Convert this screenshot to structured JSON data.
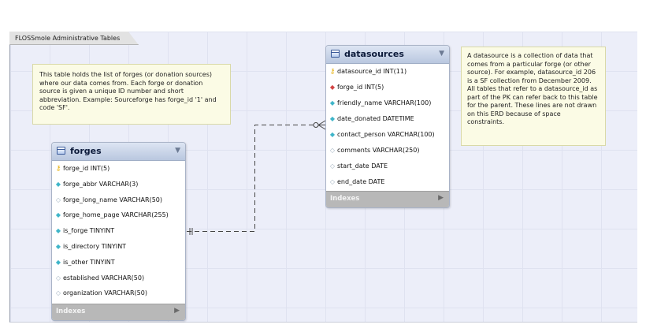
{
  "layer": {
    "title": "FLOSSmole Administrative Tables"
  },
  "notes": {
    "forges": "This table holds the list of forges (or donation sources) where our data comes from. Each forge or donation source is given a unique ID number and short abbreviation. Example: Sourceforge has forge_id '1' and code 'SF'.",
    "datasources": "A datasource is a collection of data that comes from a particular forge (or other source). For example, datasource_id 206 is a SF collection from December 2009. All tables that refer to a datasource_id as part of the PK can refer back to this table for the parent. These lines are not drawn on this ERD because of space constraints."
  },
  "tables": {
    "forges": {
      "name": "forges",
      "columns": [
        {
          "label": "forge_id INT(5)",
          "icon": "primary-key-icon"
        },
        {
          "label": "forge_abbr VARCHAR(3)",
          "icon": "not-null-column-icon"
        },
        {
          "label": "forge_long_name VARCHAR(50)",
          "icon": "nullable-column-icon"
        },
        {
          "label": "forge_home_page VARCHAR(255)",
          "icon": "not-null-column-icon"
        },
        {
          "label": "is_forge TINYINT",
          "icon": "not-null-column-icon"
        },
        {
          "label": "is_directory TINYINT",
          "icon": "not-null-column-icon"
        },
        {
          "label": "is_other TINYINT",
          "icon": "not-null-column-icon"
        },
        {
          "label": "established VARCHAR(50)",
          "icon": "nullable-column-icon"
        },
        {
          "label": "organization VARCHAR(50)",
          "icon": "nullable-column-icon"
        }
      ],
      "footer": "Indexes"
    },
    "datasources": {
      "name": "datasources",
      "columns": [
        {
          "label": "datasource_id INT(11)",
          "icon": "primary-key-icon"
        },
        {
          "label": "forge_id INT(5)",
          "icon": "foreign-key-icon"
        },
        {
          "label": "friendly_name VARCHAR(100)",
          "icon": "not-null-column-icon"
        },
        {
          "label": "date_donated DATETIME",
          "icon": "not-null-column-icon"
        },
        {
          "label": "contact_person VARCHAR(100)",
          "icon": "not-null-column-icon"
        },
        {
          "label": "comments VARCHAR(250)",
          "icon": "nullable-column-icon"
        },
        {
          "label": "start_date DATE",
          "icon": "nullable-column-icon"
        },
        {
          "label": "end_date DATE",
          "icon": "nullable-column-icon"
        }
      ],
      "footer": "Indexes"
    }
  },
  "colors": {
    "canvas": "#eceef9",
    "note": "#fbfbe5",
    "header": "#c7d3e8",
    "footer": "#b8b8b8",
    "connector": "#444444"
  }
}
